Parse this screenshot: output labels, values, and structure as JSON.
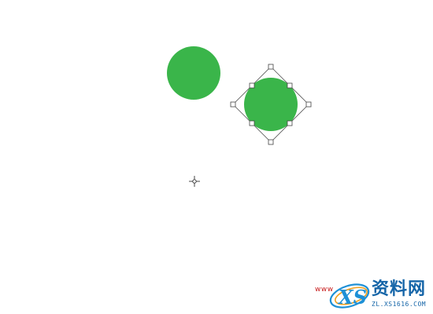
{
  "canvas": {
    "background": "#ffffff",
    "shapes": [
      {
        "name": "circle-original",
        "shape": "ellipse",
        "fill": "#3ab54a"
      },
      {
        "name": "circle-transformed",
        "shape": "ellipse",
        "fill": "#3ab54a"
      }
    ],
    "transform_box": {
      "rotation_deg": 45,
      "handle_count": 8,
      "stroke_color": "#555555",
      "handle_fill": "#ffffff"
    },
    "reference_point": {
      "icon": "crosshair-pivot-icon"
    }
  },
  "watermark": {
    "small_text": "www",
    "logo_text": "XS",
    "title": "资料网",
    "url": "ZL.XS1616.COM",
    "logo_color": "#1e90d6",
    "text_color": "#1565a8",
    "accent_color": "#c81e1e"
  }
}
